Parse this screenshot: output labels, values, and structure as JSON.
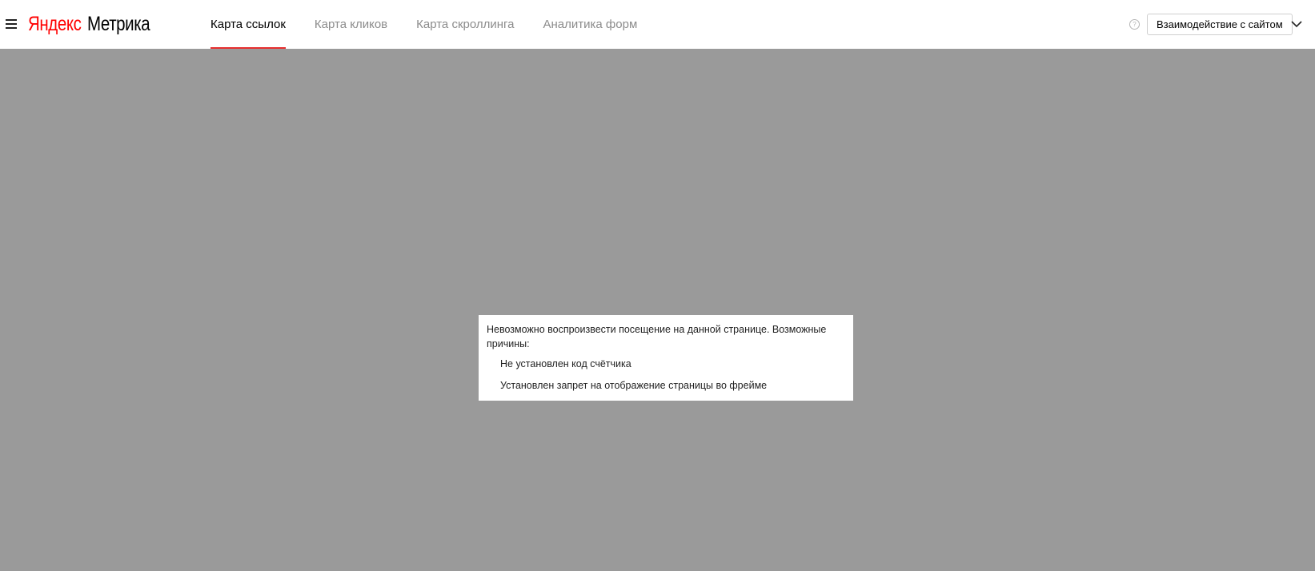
{
  "header": {
    "menu_icon": "hamburger-menu-icon",
    "logo": {
      "brand": "Яндекс",
      "product": "Метрика"
    },
    "tabs": [
      {
        "label": "Карта ссылок",
        "active": true
      },
      {
        "label": "Карта кликов",
        "active": false
      },
      {
        "label": "Карта скроллинга",
        "active": false
      },
      {
        "label": "Аналитика форм",
        "active": false
      }
    ],
    "help_icon_glyph": "?",
    "interaction_button_label": "Взаимодействие с сайтом",
    "expand_icon": "chevron-down-icon"
  },
  "message": {
    "text": "Невозможно воспроизвести посещение на данной странице. Возможные причины:",
    "reasons": [
      "Не установлен код счётчика",
      "Установлен запрет на отображение страницы во фрейме"
    ]
  },
  "colors": {
    "overlay": "#9a9a9a",
    "active_tab_underline": "#e62e2e",
    "brand_red": "#ff0000"
  }
}
